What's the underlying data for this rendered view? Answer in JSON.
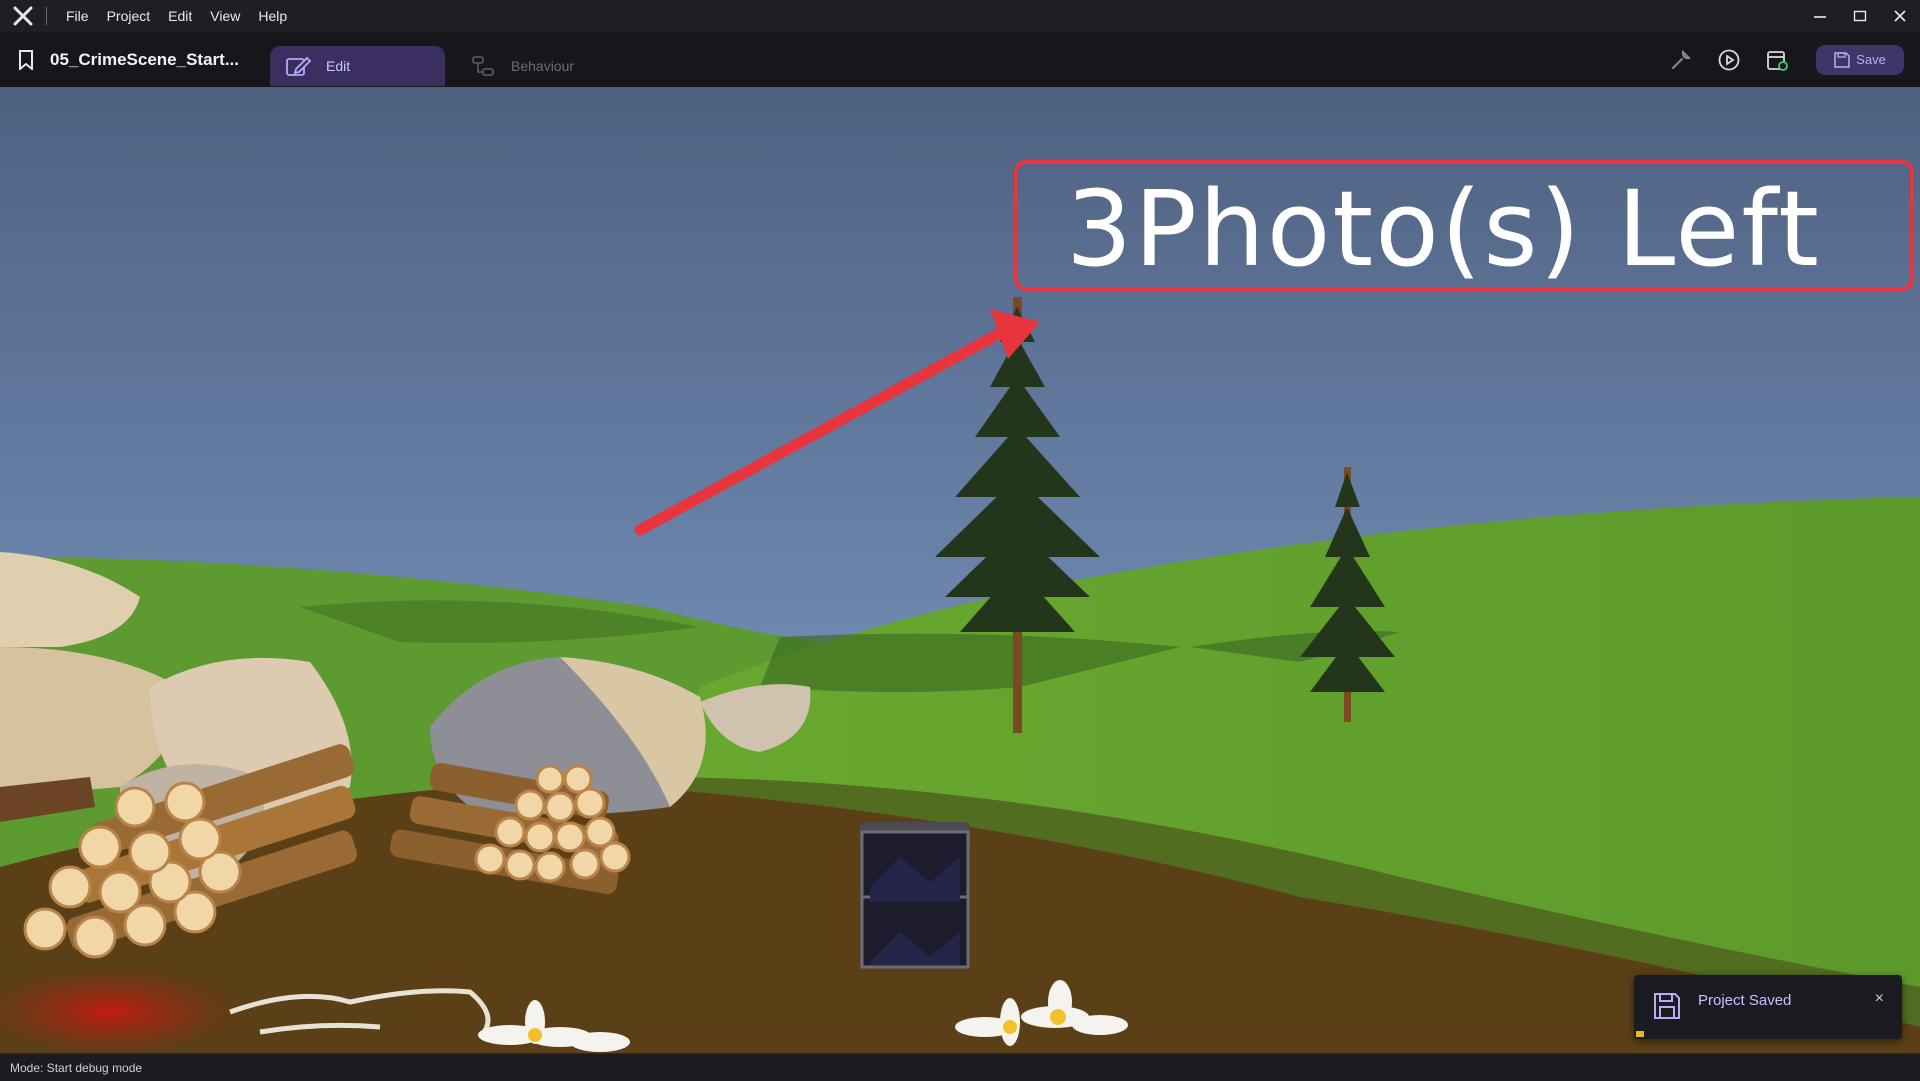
{
  "menu": {
    "items": [
      "File",
      "Project",
      "Edit",
      "View",
      "Help"
    ]
  },
  "toolbar": {
    "document_title": "05_CrimeScene_Start...",
    "tabs": [
      {
        "label": "Edit",
        "active": true
      },
      {
        "label": "Behaviour",
        "active": false
      }
    ],
    "save_label": "Save",
    "icons": [
      "wrench-icon",
      "play-icon",
      "build-icon",
      "save-icon"
    ]
  },
  "overlay": {
    "photos_left_text": "3Photo(s) Left"
  },
  "toast": {
    "message": "Project Saved",
    "close_glyph": "×"
  },
  "statusbar": {
    "mode_text": "Mode: Start debug mode"
  },
  "colors": {
    "accent": "#3a2f5e",
    "highlight_box": "#e8343c",
    "arrow": "#e8343c",
    "toast_text": "#c9c0ff"
  }
}
